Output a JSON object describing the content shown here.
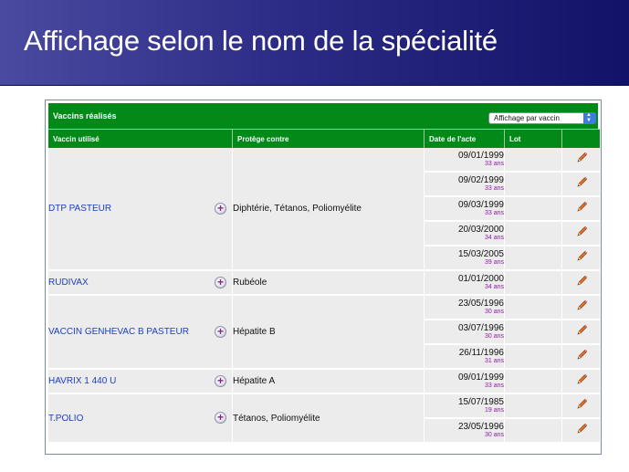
{
  "slide": {
    "title": "Affichage selon le nom de la spécialité"
  },
  "panel": {
    "title": "Vaccins réalisés",
    "select": {
      "value": "Affichage par vaccin"
    }
  },
  "columns": [
    "Vaccin utilisé",
    "Protège contre",
    "Date de l'acte",
    "Lot",
    ""
  ],
  "vaccines": [
    {
      "name": "DTP PASTEUR",
      "protects": "Diphtérie, Tétanos, Poliomyélite",
      "acts": [
        {
          "date": "09/01/1999",
          "age": "33 ans"
        },
        {
          "date": "09/02/1999",
          "age": "33 ans"
        },
        {
          "date": "09/03/1999",
          "age": "33 ans"
        },
        {
          "date": "20/03/2000",
          "age": "34 ans"
        },
        {
          "date": "15/03/2005",
          "age": "39 ans"
        }
      ]
    },
    {
      "name": "RUDIVAX",
      "protects": "Rubéole",
      "acts": [
        {
          "date": "01/01/2000",
          "age": "34 ans"
        }
      ]
    },
    {
      "name": "VACCIN GENHEVAC B PASTEUR",
      "protects": "Hépatite B",
      "acts": [
        {
          "date": "23/05/1996",
          "age": "30 ans"
        },
        {
          "date": "03/07/1996",
          "age": "30 ans"
        },
        {
          "date": "26/11/1996",
          "age": "31 ans"
        }
      ]
    },
    {
      "name": "HAVRIX 1 440 U",
      "protects": "Hépatite A",
      "acts": [
        {
          "date": "09/01/1999",
          "age": "33 ans"
        }
      ]
    },
    {
      "name": "T.POLIO",
      "protects": "Tétanos, Poliomyélite",
      "acts": [
        {
          "date": "15/07/1985",
          "age": "19 ans"
        },
        {
          "date": "23/05/1996",
          "age": "30 ans"
        }
      ]
    }
  ],
  "icons": {
    "expand": "plus-circle-icon",
    "edit": "pencil-icon"
  },
  "colors": {
    "header_green": "#018a18",
    "banner_blue": "#2c2c86",
    "link_blue": "#1c3fc0",
    "age_purple": "#8e1aa8"
  }
}
